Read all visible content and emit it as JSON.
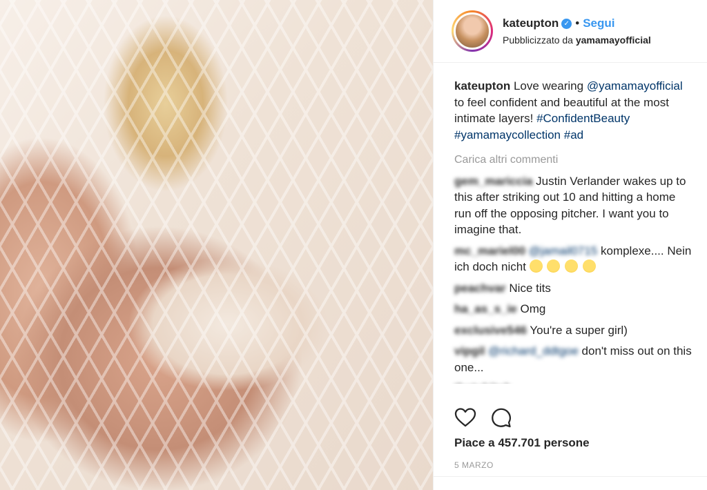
{
  "header": {
    "username": "kateupton",
    "separator": "•",
    "follow_label": "Segui",
    "sponsored_prefix": "Pubblicizzato da",
    "sponsor": "yamamayofficial"
  },
  "caption": {
    "author": "kateupton",
    "text_1": "Love wearing",
    "mention": "@yamamayofficial",
    "text_2": "to feel confident and beautiful at the most intimate layers!",
    "hashtag_1": "#ConfidentBeauty",
    "hashtag_2": "#yamamaycollection",
    "hashtag_3": "#ad"
  },
  "load_more": "Carica altri commenti",
  "comments": [
    {
      "user": "gem_mariccia",
      "mention": "",
      "text": "Justin Verlander wakes up to this after striking out 10 and hitting a home run off the opposing pitcher. I want you to imagine that."
    },
    {
      "user": "mc_mariel00",
      "mention": "@jamail0715",
      "text": "komplexe.... Nein ich doch nicht"
    },
    {
      "user": "peachvar",
      "mention": "",
      "text": "Nice tits"
    },
    {
      "user": "ha_as_s_ie",
      "mention": "",
      "text": "Omg"
    },
    {
      "user": "exclusive546",
      "mention": "",
      "text": "You're a super girl)"
    },
    {
      "user": "vipgil",
      "mention": "@richard_ddtgoe",
      "text": "don't miss out on this one..."
    },
    {
      "user": "thetubitoh",
      "mention": "",
      "text": ""
    }
  ],
  "emoji_row": [
    "heart-eyes-emoji",
    "heart-eyes-emoji",
    "crying-emoji",
    "crying-emoji"
  ],
  "likes_label": "Piace a 457.701 persone",
  "date": "5 MARZO"
}
